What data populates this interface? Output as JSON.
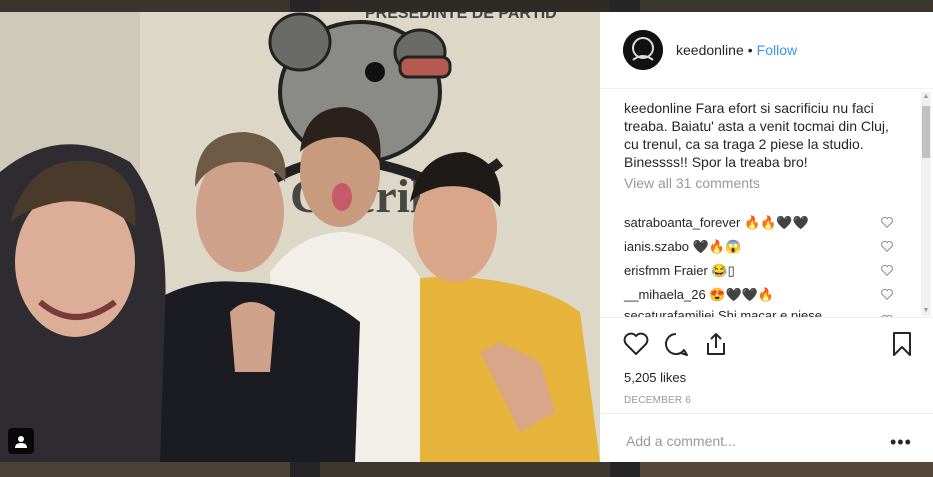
{
  "post": {
    "username": "keedonline",
    "separator": "•",
    "follow_label": "Follow",
    "caption_user": "keedonline",
    "caption_text": "Fara efort si sacrificiu nu faci treaba. Baiatu' asta a venit tocmai din Cluj, cu trenul, ca sa traga 2 piese la studio. Binessss!! Spor la treaba bro!",
    "view_all_label": "View all 31 comments",
    "comments": [
      {
        "user": "satraboanta_forever",
        "text": "🔥🔥🖤🖤"
      },
      {
        "user": "ianis.szabo",
        "text": "🖤🔥😱"
      },
      {
        "user": "erisfmm",
        "text": "Fraier 😂▯"
      },
      {
        "user": "__mihaela_26",
        "text": "😍🖤🖤🔥"
      },
      {
        "user": "secaturafamiliei",
        "text": "Shi macar e piese"
      }
    ],
    "likes": "5,205 likes",
    "date": "DECEMBER 6",
    "add_comment_placeholder": "Add a comment...",
    "more_label": "•••",
    "wall_text": "PRESEDINTE DE PARTID"
  },
  "colors": {
    "follow": "#3897f0",
    "text": "#262626",
    "muted": "#999999",
    "border": "#efefef"
  },
  "icons": [
    "heart-icon",
    "comment-icon",
    "share-icon",
    "bookmark-icon",
    "tag-user-icon"
  ]
}
